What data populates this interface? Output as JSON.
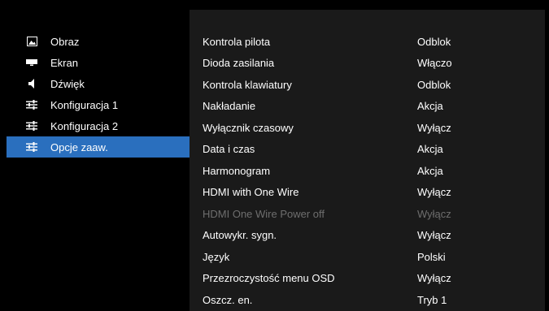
{
  "menu": {
    "items": [
      {
        "label": "Obraz",
        "icon": "image-icon",
        "selected": false
      },
      {
        "label": "Ekran",
        "icon": "screen-icon",
        "selected": false
      },
      {
        "label": "Dźwięk",
        "icon": "speaker-icon",
        "selected": false
      },
      {
        "label": "Konfiguracja 1",
        "icon": "sliders-icon",
        "selected": false
      },
      {
        "label": "Konfiguracja 2",
        "icon": "sliders-icon",
        "selected": false
      },
      {
        "label": "Opcje zaaw.",
        "icon": "sliders-icon",
        "selected": true
      }
    ]
  },
  "settings": {
    "rows": [
      {
        "name": "Kontrola pilota",
        "value": "Odblok",
        "enabled": true
      },
      {
        "name": "Dioda zasilania",
        "value": "Włączo",
        "enabled": true
      },
      {
        "name": "Kontrola klawiatury",
        "value": "Odblok",
        "enabled": true
      },
      {
        "name": "Nakładanie",
        "value": "Akcja",
        "enabled": true
      },
      {
        "name": "Wyłącznik czasowy",
        "value": "Wyłącz",
        "enabled": true
      },
      {
        "name": "Data i czas",
        "value": "Akcja",
        "enabled": true
      },
      {
        "name": "Harmonogram",
        "value": "Akcja",
        "enabled": true
      },
      {
        "name": "HDMI with One Wire",
        "value": "Wyłącz",
        "enabled": true
      },
      {
        "name": "HDMI One Wire Power off",
        "value": "Wyłącz",
        "enabled": false
      },
      {
        "name": "Autowykr. sygn.",
        "value": "Wyłącz",
        "enabled": true
      },
      {
        "name": "Język",
        "value": "Polski",
        "enabled": true
      },
      {
        "name": "Przezroczystość menu OSD",
        "value": "Wyłącz",
        "enabled": true
      },
      {
        "name": "Oszcz. en.",
        "value": "Tryb 1",
        "enabled": true
      }
    ]
  },
  "colors": {
    "selected_bg": "#2a6fbe",
    "panel_bg": "#1a1a1a",
    "disabled_text": "#6e6e6e"
  }
}
